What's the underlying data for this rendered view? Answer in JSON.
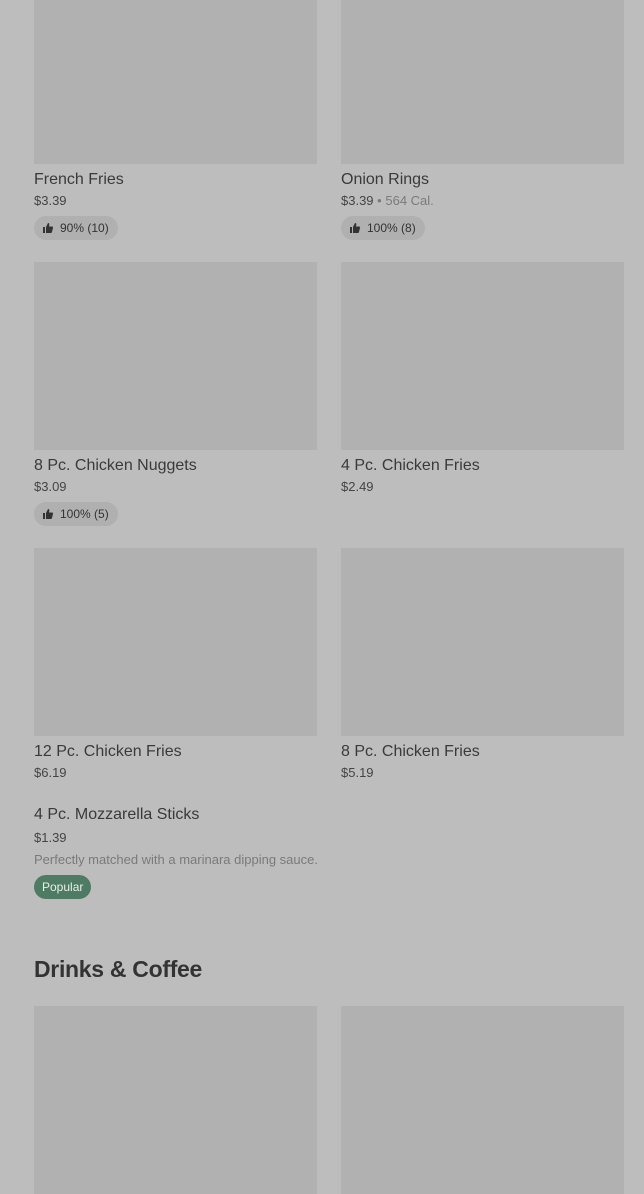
{
  "items": [
    {
      "name": "French Fries",
      "price": "$3.39",
      "rating": "90% (10)"
    },
    {
      "name": "Onion Rings",
      "price": "$3.39",
      "calories": "564 Cal.",
      "rating": "100% (8)"
    },
    {
      "name": "8 Pc. Chicken Nuggets",
      "price": "$3.09",
      "rating": "100% (5)"
    },
    {
      "name": "4 Pc. Chicken Fries",
      "price": "$2.49"
    },
    {
      "name": "12 Pc. Chicken Fries",
      "price": "$6.19"
    },
    {
      "name": "8 Pc. Chicken Fries",
      "price": "$5.19"
    }
  ],
  "featured": {
    "name": "4 Pc. Mozzarella Sticks",
    "price": "$1.39",
    "description": "Perfectly matched with a marinara dipping sauce.",
    "badge": "Popular"
  },
  "sections": {
    "drinks_title": "Drinks & Coffee"
  },
  "colors": {
    "badge_bg": "#4f7a64",
    "image_placeholder": "#b1b1b1",
    "page_bg": "#bdbdbd"
  },
  "icons": {
    "rating": "thumbs-up-icon"
  }
}
